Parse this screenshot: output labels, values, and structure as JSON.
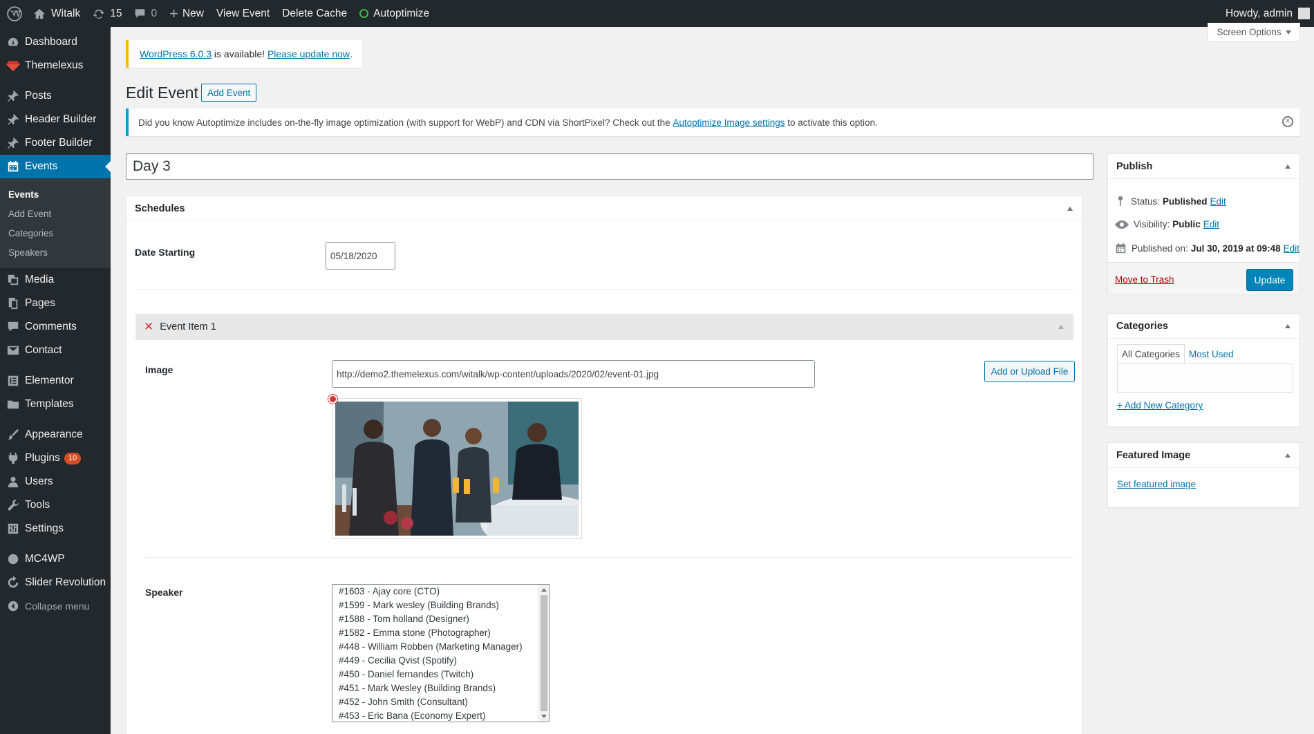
{
  "adminbar": {
    "site_name": "Witalk",
    "updates_count": "15",
    "comments_count": "0",
    "new_label": "New",
    "view_event": "View Event",
    "delete_cache": "Delete Cache",
    "autoptimize": "Autoptimize",
    "howdy": "Howdy, admin"
  },
  "sidebar": {
    "items": [
      {
        "label": "Dashboard",
        "icon": "dashboard-icon"
      },
      {
        "label": "Themelexus",
        "icon": "gem-icon"
      },
      {
        "label": "Posts",
        "icon": "pin-icon"
      },
      {
        "label": "Header Builder",
        "icon": "pin-icon"
      },
      {
        "label": "Footer Builder",
        "icon": "pin-icon"
      },
      {
        "label": "Events",
        "icon": "calendar-icon"
      },
      {
        "label": "Media",
        "icon": "media-icon"
      },
      {
        "label": "Pages",
        "icon": "pages-icon"
      },
      {
        "label": "Comments",
        "icon": "comment-icon"
      },
      {
        "label": "Contact",
        "icon": "mail-icon"
      },
      {
        "label": "Elementor",
        "icon": "elementor-icon"
      },
      {
        "label": "Templates",
        "icon": "folder-icon"
      },
      {
        "label": "Appearance",
        "icon": "brush-icon"
      },
      {
        "label": "Plugins",
        "icon": "plugin-icon",
        "badge": "10"
      },
      {
        "label": "Users",
        "icon": "user-icon"
      },
      {
        "label": "Tools",
        "icon": "wrench-icon"
      },
      {
        "label": "Settings",
        "icon": "settings-icon"
      },
      {
        "label": "MC4WP",
        "icon": "mc4wp-icon"
      },
      {
        "label": "Slider Revolution",
        "icon": "refresh-icon"
      }
    ],
    "events_submenu": [
      "Events",
      "Add Event",
      "Categories",
      "Speakers"
    ],
    "collapse": "Collapse menu"
  },
  "screen_options": "Screen Options",
  "update_nag": {
    "link1": "WordPress 6.0.3",
    "middle": " is available! ",
    "link2": "Please update now",
    "end": "."
  },
  "page": {
    "title": "Edit Event",
    "add_button": "Add Event"
  },
  "notice": {
    "text_before": "Did you know Autoptimize includes on-the-fly image optimization (with support for WebP) and CDN via ShortPixel? Check out the ",
    "link": "Autoptimize Image settings",
    "text_after": " to activate this option."
  },
  "post_title": "Day 3",
  "schedules": {
    "header": "Schedules",
    "date_label": "Date Starting",
    "date_value": "05/18/2020",
    "event_item_title": "Event Item 1",
    "image_label": "Image",
    "image_url": "http://demo2.themelexus.com/witalk/wp-content/uploads/2020/02/event-01.jpg",
    "upload_button": "Add or Upload File",
    "speaker_label": "Speaker",
    "speakers": [
      "#1603 - Ajay core (CTO)",
      "#1599 - Mark wesley (Building Brands)",
      "#1588 - Tom holland (Designer)",
      "#1582 - Emma stone (Photographer)",
      "#448 - William Robben (Marketing Manager)",
      "#449 - Cecilia Qvist (Spotify)",
      "#450 - Daniel fernandes (Twitch)",
      "#451 - Mark Wesley (Building Brands)",
      "#452 - John Smith (Consultant)",
      "#453 - Eric Bana (Economy Expert)"
    ]
  },
  "publish": {
    "header": "Publish",
    "status_label": "Status:",
    "status_value": "Published",
    "visibility_label": "Visibility:",
    "visibility_value": "Public",
    "published_label": "Published on:",
    "published_value": "Jul 30, 2019 at 09:48",
    "edit": "Edit",
    "trash": "Move to Trash",
    "update": "Update"
  },
  "categories": {
    "header": "Categories",
    "tab_all": "All Categories",
    "tab_most": "Most Used",
    "add_new": "+ Add New Category"
  },
  "featured": {
    "header": "Featured Image",
    "link": "Set featured image"
  }
}
